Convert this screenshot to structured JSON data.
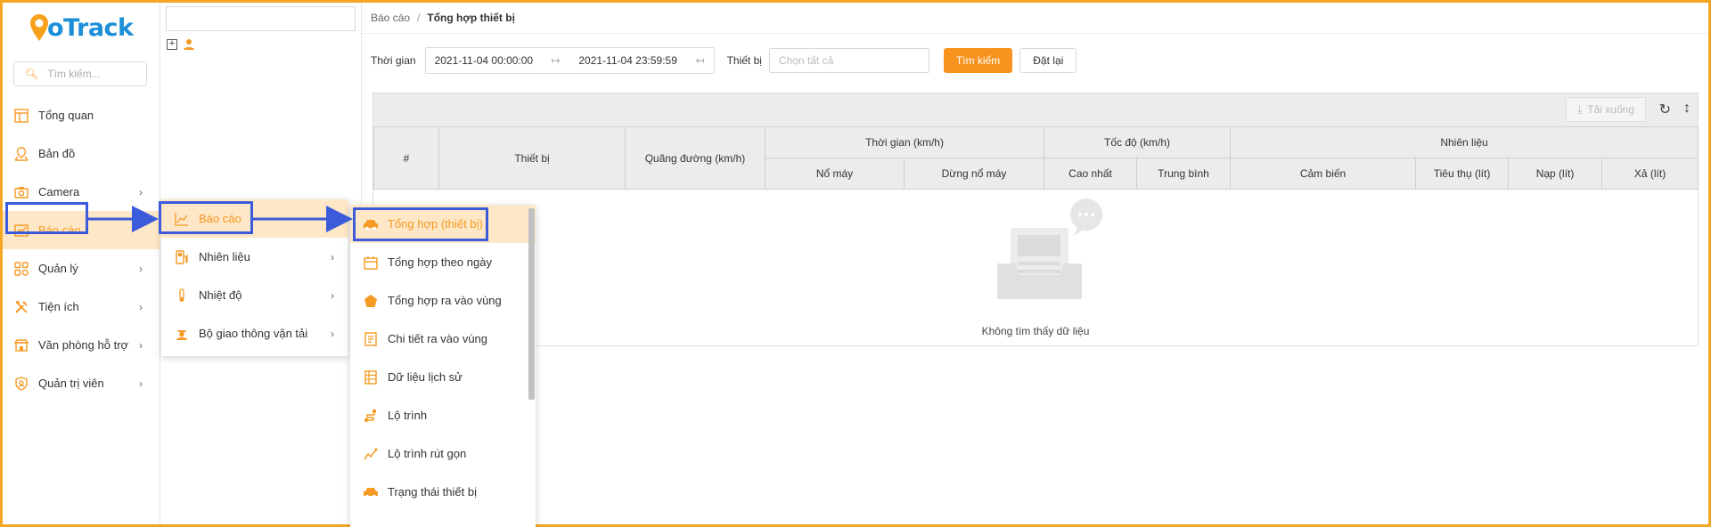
{
  "app": {
    "logo_g": "G",
    "logo_rest": "oTrack"
  },
  "sidebar": {
    "search_placeholder": "Tìm kiếm...",
    "items": [
      {
        "label": "Tổng quan",
        "icon": "overview-icon",
        "has_children": false
      },
      {
        "label": "Bản đồ",
        "icon": "map-icon",
        "has_children": false
      },
      {
        "label": "Camera",
        "icon": "camera-icon",
        "has_children": true
      },
      {
        "label": "Báo cáo",
        "icon": "report-icon",
        "has_children": true,
        "active": true
      },
      {
        "label": "Quản lý",
        "icon": "manage-icon",
        "has_children": true
      },
      {
        "label": "Tiện ích",
        "icon": "tools-icon",
        "has_children": true
      },
      {
        "label": "Văn phòng hỗ trợ",
        "icon": "office-icon",
        "has_children": true
      },
      {
        "label": "Quản trị viên",
        "icon": "admin-icon",
        "has_children": true
      }
    ]
  },
  "breadcrumb": {
    "parent": "Báo cáo",
    "current": "Tổng hợp thiết bị"
  },
  "filter": {
    "time_label": "Thời gian",
    "date_from": "2021-11-04 00:00:00",
    "date_to": "2021-11-04 23:59:59",
    "device_label": "Thiết bị",
    "device_placeholder": "Chọn tất cả",
    "search_button": "Tìm kiếm",
    "reset_button": "Đặt lại"
  },
  "toolbar": {
    "download_label": "Tải xuống"
  },
  "table": {
    "col_index": "#",
    "col_device": "Thiết bị",
    "col_distance": "Quãng đường (km/h)",
    "group_time": "Thời gian (km/h)",
    "group_speed": "Tốc độ (km/h)",
    "group_fuel": "Nhiên liệu",
    "sub_engine_on": "Nổ máy",
    "sub_idle": "Dừng nổ máy",
    "sub_max": "Cao nhất",
    "sub_avg": "Trung bình",
    "sub_sensor": "Cảm biến",
    "sub_consume": "Tiêu thụ (lít)",
    "sub_refill": "Nạp (lít)",
    "sub_drain": "Xả (lít)",
    "empty_text": "Không tìm thấy dữ liệu"
  },
  "flyout1": {
    "items": [
      {
        "label": "Báo cáo",
        "active": true
      },
      {
        "label": "Nhiên liệu"
      },
      {
        "label": "Nhiệt độ"
      },
      {
        "label": "Bộ giao thông vận tải"
      }
    ]
  },
  "flyout2": {
    "items": [
      {
        "label": "Tổng hợp (thiết bị)",
        "active": true
      },
      {
        "label": "Tổng hợp theo ngày"
      },
      {
        "label": "Tổng hợp ra vào vùng"
      },
      {
        "label": "Chi tiết ra vào vùng"
      },
      {
        "label": "Dữ liệu lịch sử"
      },
      {
        "label": "Lộ trình"
      },
      {
        "label": "Lộ trình rút gọn"
      },
      {
        "label": "Trạng thái thiết bị"
      }
    ]
  },
  "colors": {
    "accent": "#f7931e",
    "highlight": "#3b5bdb",
    "active_bg": "#fde7c6",
    "frame": "#f5a623"
  }
}
